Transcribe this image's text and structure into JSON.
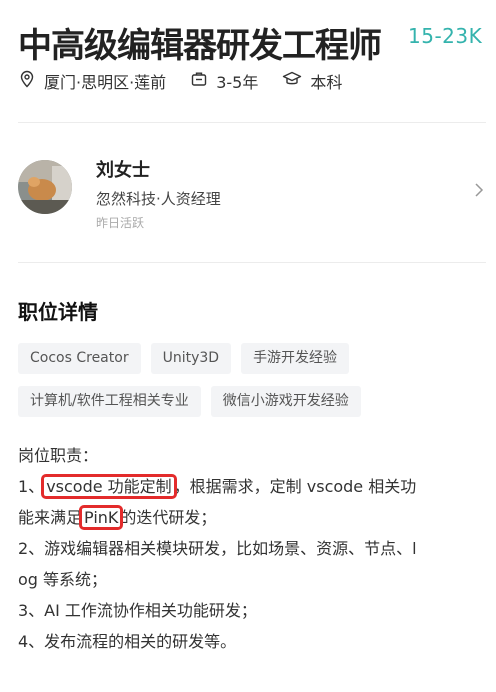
{
  "job": {
    "title": "中高级编辑器研发工程师",
    "salary": "15-23K",
    "location": "厦门·思明区·莲前",
    "experience": "3-5年",
    "education": "本科"
  },
  "recruiter": {
    "name": "刘女士",
    "company_role": "忽然科技·人资经理",
    "active_status": "昨日活跃"
  },
  "details": {
    "section_title": "职位详情",
    "tags_row1": [
      "Cocos Creator",
      "Unity3D",
      "手游开发经验"
    ],
    "tags_row2": [
      "计算机/软件工程相关专业",
      "微信小游戏开发经验"
    ],
    "desc_heading": "岗位职责：",
    "line1_prefix": "1、",
    "line1_highlight": "vscode 功能定制",
    "line1_suffix": "，根据需求，定制 vscode 相关功",
    "line2_prefix": "能来满足",
    "line2_highlight": "PinK",
    "line2_suffix": "的迭代研发；",
    "line3": "2、游戏编辑器相关模块研发，比如场景、资源、节点、l",
    "line4": "og 等系统；",
    "line5": "3、AI 工作流协作相关功能研发；",
    "line6": "4、发布流程的相关的研发等。"
  },
  "colors": {
    "salary": "#34b3ad",
    "highlight_box": "#e32b2b",
    "tag_bg": "#f3f4f6"
  }
}
